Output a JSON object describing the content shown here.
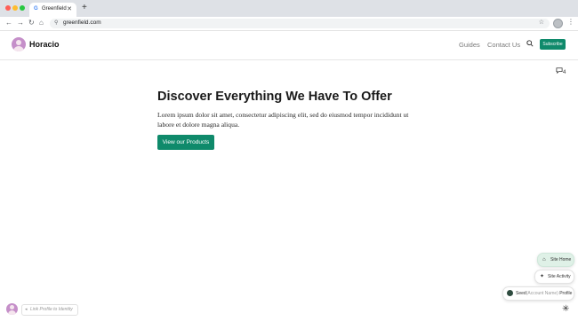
{
  "browser": {
    "tab_title": "Greenfield",
    "tab_favicon": "G",
    "tab_close": "✕",
    "new_tab": "+",
    "url": "greenfield.com",
    "nav_icons": {
      "back": "←",
      "forward": "→",
      "reload": "↻",
      "home": "⌂"
    }
  },
  "site": {
    "name": "Horacio",
    "nav": [
      "Guides",
      "Contact Us"
    ],
    "subscribe_label": "Subscribe",
    "accent_color": "#0f8a6b"
  },
  "main": {
    "comment_count": "4",
    "hero_title": "Discover Everything We Have To Offer",
    "hero_text": "Lorem ipsum dolor sit amet, consectetur adipiscing elit, sed do eiusmod tempor incididunt ut labore et dolore magna aliqua.",
    "cta_label": "View our Products"
  },
  "widgets": {
    "site_home": "Site Home",
    "site_activity": "Site Activity",
    "profile": {
      "name": "Seed",
      "note": "(Account Name)",
      "suffix": "Profile"
    },
    "link_profile": "Link Profile to Identity"
  }
}
